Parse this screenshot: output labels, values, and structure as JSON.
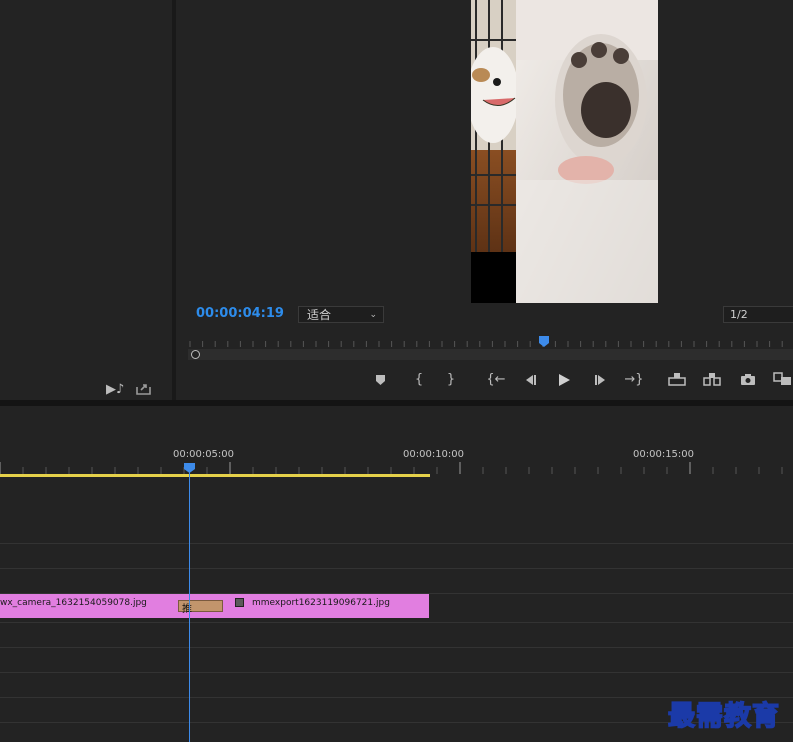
{
  "program_monitor": {
    "timecode": "00:00:04:19",
    "fit_select_value": "适合",
    "resolution_value": "1/2",
    "transport_icons": [
      "add-marker-icon",
      "mark-in-icon",
      "mark-out-icon",
      "go-to-in-icon",
      "step-back-icon",
      "play-icon",
      "step-forward-icon",
      "go-to-out-icon",
      "lift-icon",
      "extract-icon",
      "export-frame-icon",
      "button-editor-icon"
    ]
  },
  "project_panel": {
    "icons": [
      "audio-icon",
      "export-icon"
    ]
  },
  "timeline": {
    "ruler_labels": [
      "00:00:05:00",
      "00:00:10:00",
      "00:00:15:00"
    ],
    "clips": [
      {
        "name": "wx_camera_1632154059078.jpg"
      },
      {
        "name": "mmexport1623119096721.jpg"
      }
    ],
    "transition_label": "推",
    "clip_color": "#e17ee0",
    "playhead_color": "#3d8bea",
    "work_area_color": "#e5d14a"
  },
  "watermark": {
    "text": "最需教育"
  }
}
